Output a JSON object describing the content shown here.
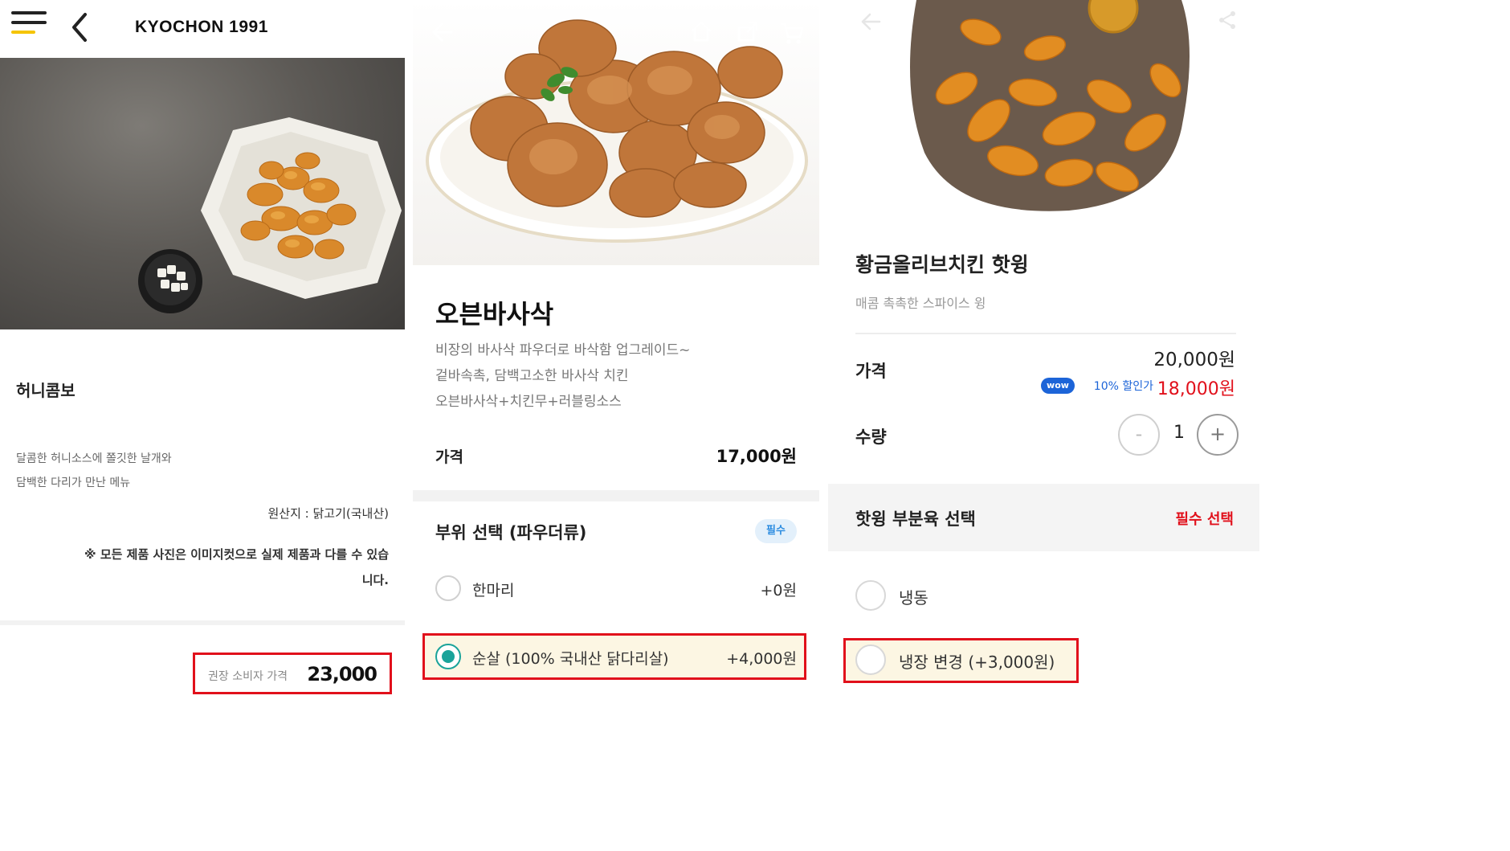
{
  "panel1": {
    "brand": "KYOCHON 1991",
    "product_title": "허니콤보",
    "desc_line1": "달콤한 허니소스에 쫄깃한 날개와",
    "desc_line2": "담백한 다리가 만난 메뉴",
    "origin": "원산지 : 닭고기(국내산)",
    "notice_line1": "※ 모든 제품 사진은 이미지컷으로 실제 제품과 다를 수 있습",
    "notice_line2": "니다.",
    "price_label": "권장 소비자 가격",
    "price_value": "23,000"
  },
  "panel2": {
    "product_title": "오븐바사삭",
    "desc_line1": "비장의 바사삭 파우더로 바삭함 업그레이드~",
    "desc_line2": "겉바속촉, 담백고소한 바사삭 치킨",
    "desc_line3": "오븐바사삭+치킨무+러블링소스",
    "price_label": "가격",
    "price_value": "17,000원",
    "section_title": "부위 선택 (파우더류)",
    "required_badge": "필수",
    "options": [
      {
        "label": "한마리",
        "price": "+0원",
        "selected": false
      },
      {
        "label": "순살 (100% 국내산 닭다리살)",
        "price": "+4,000원",
        "selected": true
      }
    ]
  },
  "panel3": {
    "product_title": "황금올리브치킨 핫윙",
    "subtitle": "매콤 촉촉한 스파이스 윙",
    "price_label": "가격",
    "price_original": "20,000원",
    "wow_badge": "wow",
    "discount_label": "10% 할인가",
    "price_sale": "18,000원",
    "qty_label": "수량",
    "qty_minus": "-",
    "qty_value": "1",
    "qty_plus": "+",
    "section_title": "핫윙 부분육 선택",
    "section_required": "필수 선택",
    "options": [
      {
        "label": "냉동",
        "selected": false
      },
      {
        "label": "냉장 변경 (+3,000원)",
        "selected": false
      }
    ]
  },
  "colors": {
    "highlight_border": "#e1101b",
    "sale_red": "#e1101b",
    "wow_blue": "#1c64d8",
    "radio_selected": "#1aa39a",
    "required_badge_bg": "#e3f0fb",
    "option_highlight_bg": "#fcf6e3"
  },
  "icons": [
    "menu-icon",
    "back-icon",
    "home-icon",
    "share-icon",
    "cart-icon"
  ]
}
